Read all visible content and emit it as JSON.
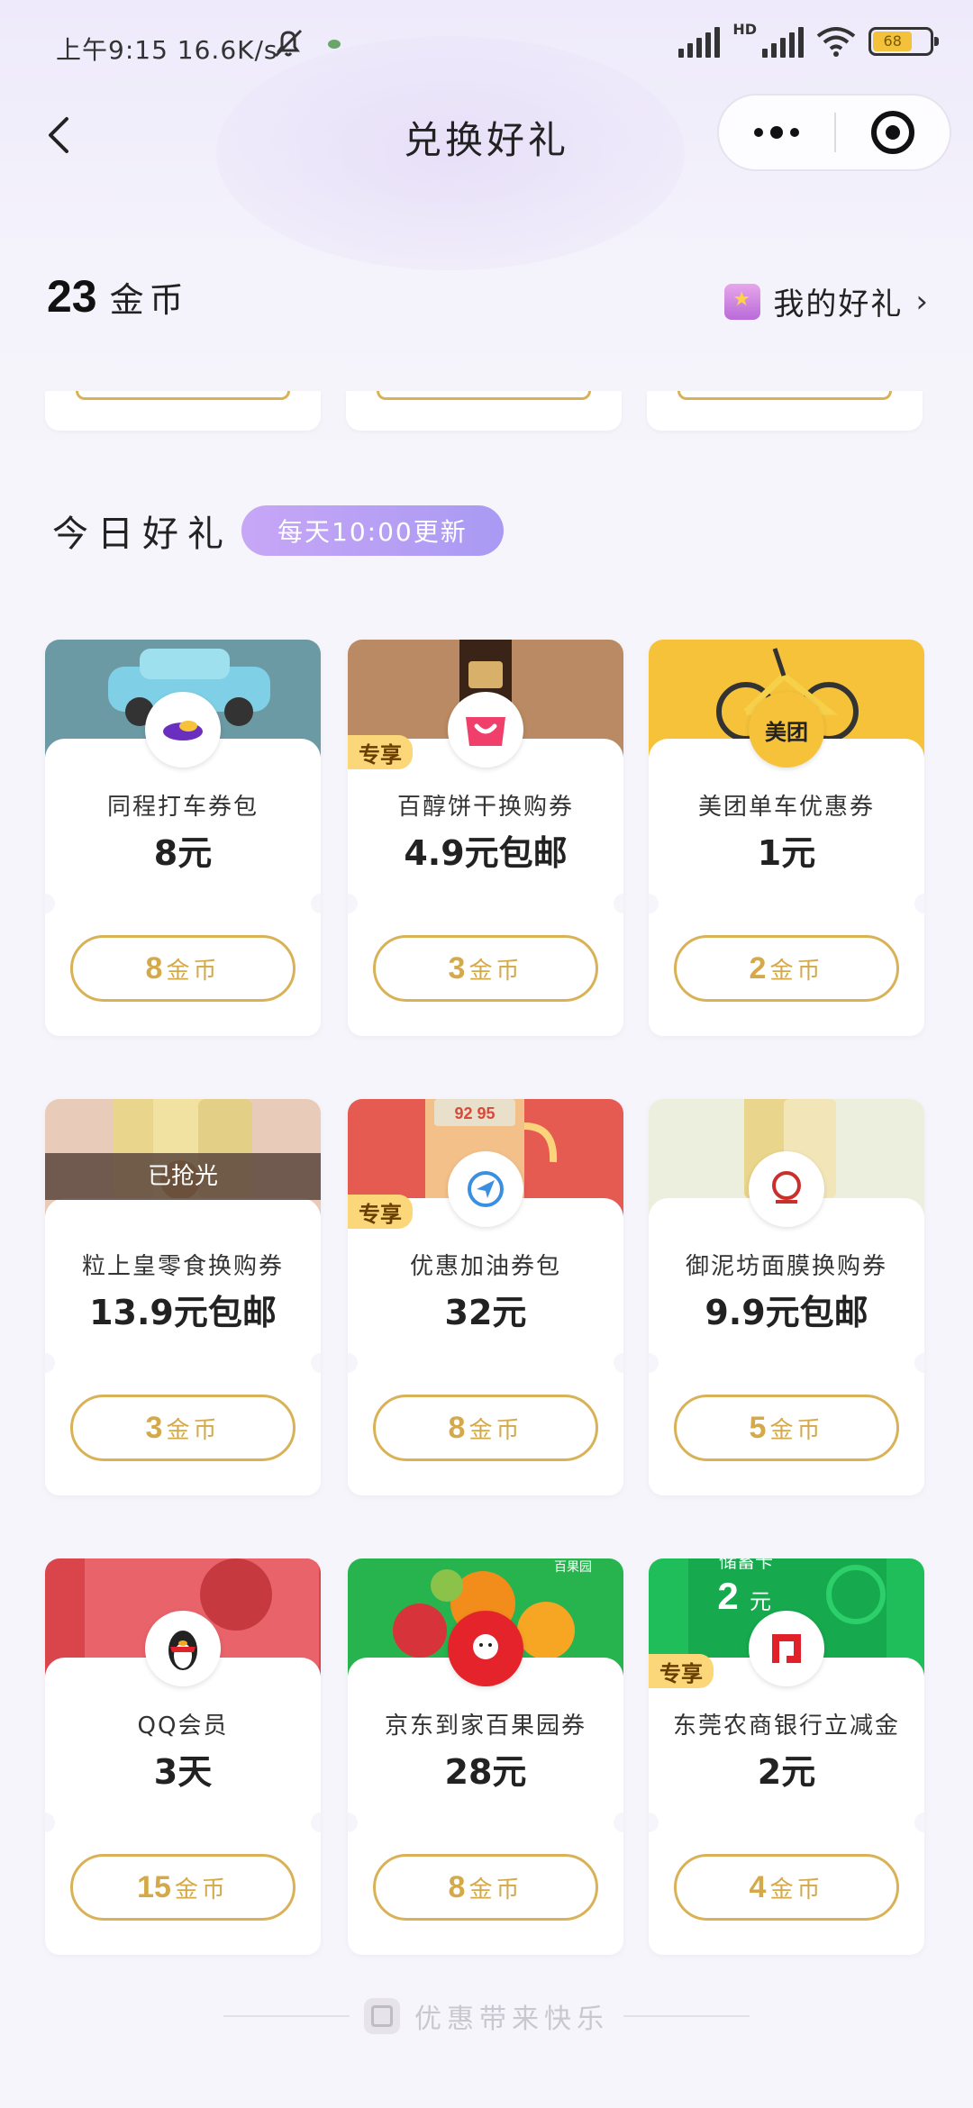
{
  "status": {
    "time": "上午9:15",
    "speed": "16.6K/s",
    "network": "HD",
    "battery": "68"
  },
  "nav": {
    "title": "兑换好礼"
  },
  "header": {
    "coins": "23",
    "coins_unit": "金币",
    "my_gifts": "我的好礼"
  },
  "section": {
    "title": "今日好礼",
    "badge": "每天10:00更新"
  },
  "cards": [
    {
      "name": "同程打车券包",
      "price": "8元",
      "coin": "8",
      "unit": "金币",
      "tag": "",
      "banner": "#6c9aa4",
      "sold": ""
    },
    {
      "name": "百醇饼干换购券",
      "price": "4.9元包邮",
      "coin": "3",
      "unit": "金币",
      "tag": "专享",
      "banner": "#b98a63",
      "sold": ""
    },
    {
      "name": "美团单车优惠券",
      "price": "1元",
      "coin": "2",
      "unit": "金币",
      "tag": "",
      "banner": "#f5c23a",
      "sold": ""
    },
    {
      "name": "粒上皇零食换购券",
      "price": "13.9元包邮",
      "coin": "3",
      "unit": "金币",
      "tag": "",
      "banner": "#e8cbb9",
      "sold": "已抢光"
    },
    {
      "name": "优惠加油券包",
      "price": "32元",
      "coin": "8",
      "unit": "金币",
      "tag": "专享",
      "banner": "#e55a51",
      "sold": ""
    },
    {
      "name": "御泥坊面膜换购券",
      "price": "9.9元包邮",
      "coin": "5",
      "unit": "金币",
      "tag": "",
      "banner": "#ecefde",
      "sold": ""
    },
    {
      "name": "QQ会员",
      "price": "3天",
      "coin": "15",
      "unit": "金币",
      "tag": "",
      "banner": "#d9454b",
      "sold": ""
    },
    {
      "name": "京东到家百果园券",
      "price": "28元",
      "coin": "8",
      "unit": "金币",
      "tag": "",
      "banner": "#27b34e",
      "sold": ""
    },
    {
      "name": "东莞农商银行立减金",
      "price": "2元",
      "coin": "4",
      "unit": "金币",
      "tag": "专享",
      "banner": "#1fbe5a",
      "sold": ""
    }
  ],
  "banner_text": {
    "meituan": "美团",
    "gas_display": "92 95",
    "deposit_card": "储蓄卡",
    "deposit_amount": "2",
    "deposit_unit": "元",
    "fruit_brand": "百果园"
  },
  "footer": {
    "text": "优惠带来快乐"
  }
}
